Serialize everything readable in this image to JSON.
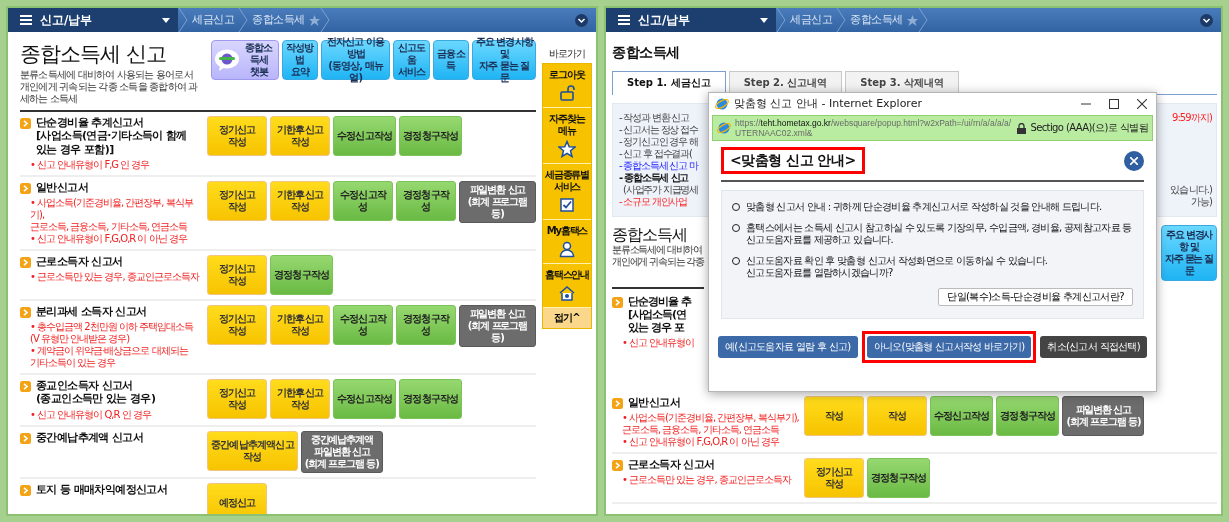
{
  "left_page": {
    "nav": {
      "menu_label": "신고/납부",
      "crumbs": [
        "세금신고",
        "종합소득세"
      ]
    },
    "title": "종합소득세 신고",
    "subtitle": "분류소득세에 대비하여 사용되는 용어로서\n개인에게 귀속되는 각종 소득을 종합하여 과세하는 소득세",
    "top_buttons": [
      {
        "label": "종합소득세\n챗봇",
        "kind": "chatbot"
      },
      {
        "label": "작성방법\n요약",
        "kind": "link"
      },
      {
        "label": "전자신고 이용방법\n(동영상, 매뉴얼)",
        "kind": "link"
      },
      {
        "label": "신고도움\n서비스",
        "kind": "link"
      },
      {
        "label": "금융소득",
        "kind": "link"
      },
      {
        "label": "주요 변경사항 및\n자주 묻는 질문",
        "kind": "link"
      }
    ],
    "sections": [
      {
        "title": "단순경비율 추계신고서\n[사업소득(연금·기타소득이 함께\n있는 경우 포함)]",
        "notes": [
          "• 신고 안내유형이 F,G 인 경우"
        ],
        "buttons": [
          {
            "label": "정기신고\n작성",
            "kind": "filing"
          },
          {
            "label": "기한후신고\n작성",
            "kind": "filing"
          },
          {
            "label": "수정신고작성",
            "kind": "correction"
          },
          {
            "label": "경정청구작성",
            "kind": "correction"
          }
        ]
      },
      {
        "title": "일반신고서",
        "notes": [
          "• 사업소득(기준경비율, 간편장부, 복식부기),\n근로소득, 금융소득, 기타소득, 연금소득",
          "• 신고 안내유형이 F,G,O,R 이 아닌 경우"
        ],
        "buttons": [
          {
            "label": "정기신고\n작성",
            "kind": "filing"
          },
          {
            "label": "기한후신고\n작성",
            "kind": "filing"
          },
          {
            "label": "수정신고작성",
            "kind": "correction"
          },
          {
            "label": "경정청구작성",
            "kind": "correction"
          },
          {
            "label": "파일변환 신고\n(회계 프로그램 등)",
            "kind": "conversion"
          }
        ]
      },
      {
        "title": "근로소득자 신고서",
        "notes": [
          "• 근로소득만 있는 경우, 종교인근로소득자"
        ],
        "buttons": [
          {
            "label": "정기신고\n작성",
            "kind": "filing"
          },
          {
            "label": "경정청구작성",
            "kind": "correction"
          }
        ]
      },
      {
        "title": "분리과세 소득자 신고서",
        "notes": [
          "• 총수입금액 2천만원 이하 주택임대소득\n(V 유형만 안내받은 경우)",
          "• 계약금이 위약금·배상금으로 대체되는\n기타소득이 있는 경우"
        ],
        "buttons": [
          {
            "label": "정기신고\n작성",
            "kind": "filing"
          },
          {
            "label": "기한후신고\n작성",
            "kind": "filing"
          },
          {
            "label": "수정신고작성",
            "kind": "correction"
          },
          {
            "label": "경정청구작성",
            "kind": "correction"
          },
          {
            "label": "파일변환 신고\n(회계 프로그램 등)",
            "kind": "conversion"
          }
        ]
      },
      {
        "title": "종교인소득자 신고서\n(종교인소득만 있는 경우)",
        "notes": [
          "• 신고 안내유형이 Q,R 인 경우"
        ],
        "buttons": [
          {
            "label": "정기신고\n작성",
            "kind": "filing"
          },
          {
            "label": "기한후신고\n작성",
            "kind": "filing"
          },
          {
            "label": "수정신고작성",
            "kind": "correction"
          },
          {
            "label": "경정청구작성",
            "kind": "correction"
          }
        ]
      },
      {
        "title": "중간예납추계액 신고서",
        "buttons": [
          {
            "label": "중간예납추계액신고\n작성",
            "kind": "filing"
          },
          {
            "label": "중간예납추계액\n파일변환 신고\n(회계 프로그램 등)",
            "kind": "conversion"
          }
        ]
      },
      {
        "title": "토지 등 매매차익예정신고서",
        "buttons": [
          {
            "label": "예정신고",
            "kind": "filing"
          }
        ]
      }
    ],
    "quick_menu": {
      "title": "바로가기",
      "items": [
        {
          "label": "로그아웃",
          "kind": "logout"
        },
        {
          "label": "자주찾는\n메뉴",
          "kind": "favorite"
        },
        {
          "label": "세금종류별\n서비스",
          "kind": "service"
        },
        {
          "label": "My홈택스",
          "kind": "account"
        },
        {
          "label": "홈택스안내",
          "kind": "guide"
        }
      ],
      "collapse": "접기^"
    }
  },
  "right_page": {
    "nav": {
      "menu_label": "신고/납부",
      "crumbs": [
        "세금신고",
        "종합소득세"
      ]
    },
    "heading": "종합소득세",
    "tabs": [
      {
        "label": "Step 1. 세금신고",
        "selected": true
      },
      {
        "label": "Step 2. 신고내역",
        "selected": false
      },
      {
        "label": "Step 3. 삭제내역",
        "selected": false
      }
    ],
    "notice_lines": [
      {
        "text": "- 작성과 변환 신고",
        "kind": "plain",
        "tail": {
          "text": "9:59까지)",
          "kind": "red"
        }
      },
      {
        "text": "- 신고서는 정상 접수",
        "kind": "plain"
      },
      {
        "text": "- 정기신고인 경우 해",
        "kind": "plain"
      },
      {
        "text": "- 신고 후 접수결과(",
        "kind": "plain"
      },
      {
        "text": "- 종합소득세 신고 마",
        "kind": "blue"
      },
      {
        "text": "- 종합소득세 신고",
        "kind": "bold"
      },
      {
        "text": "(사업주가 지급명세",
        "kind": "indent",
        "tail": {
          "text": "있습니다.)",
          "kind": "plain"
        }
      },
      {
        "text": "- 소규모 개인사업",
        "kind": "red",
        "tail": {
          "text": "가능)",
          "kind": "plain"
        }
      }
    ],
    "title": "종합소득세",
    "subtitle": "분류소득세에 대비하여\n개인에게 귀속되는 각종",
    "faq_button": "주요 변경사항 및\n자주 묻는 질문",
    "partial_section": {
      "title": "단순경비율 추\n[사업소득(연\n있는 경우 포",
      "notes": [
        "• 신고 안내유형이"
      ]
    },
    "sections": [
      {
        "title": "일반신고서",
        "notes": [
          "• 사업소득(기준경비율, 간편장부, 복식부기),\n근로소득, 금융소득, 기타소득, 연금소득",
          "• 신고 안내유형이 F,G,O,R 이 아닌 경우"
        ],
        "buttons": [
          {
            "label": "작성",
            "kind": "filing"
          },
          {
            "label": "작성",
            "kind": "filing"
          },
          {
            "label": "수정신고작성",
            "kind": "correction"
          },
          {
            "label": "경정청구작성",
            "kind": "correction"
          },
          {
            "label": "파일변환 신고\n(회계 프로그램 등)",
            "kind": "conversion"
          }
        ]
      },
      {
        "title": "근로소득자 신고서",
        "notes": [
          "• 근로소득만 있는 경우, 종교인근로소득자"
        ],
        "buttons": [
          {
            "label": "정기신고\n작성",
            "kind": "filing"
          },
          {
            "label": "경정청구작성",
            "kind": "correction"
          }
        ]
      }
    ],
    "popup": {
      "window_title": "맞춤형 신고 안내 - Internet Explorer",
      "url": {
        "scheme": "https://",
        "host": "teht.hometax.go.kr",
        "path": "/websquare/popup.html?w2xPath=/ui/rn/a/a/a/a/UTERNAAC02.xml&"
      },
      "certificate": "Sectigo (AAA)(으)로 식별됨",
      "heading": "<맞춤형 신고 안내>",
      "heading_highlighted": true,
      "items": [
        "맞춤형 신고서 안내 : 귀하께 단순경비율 추계신고서로 작성하실 것을 안내해 드립니다.",
        "홈택스에서는 소득세 신고시 참고하실 수 있도록 기장의무, 수입금액, 경비율, 공제참고자료 등\n신고도움자료를 제공하고 있습니다.",
        "신고도움자료 확인 후 맞춤형 신고서 작성화면으로 이동하실 수 있습니다.\n신고도움자료를 열람하시겠습니까?"
      ],
      "help_button": "단일(복수)소득-단순경비율 추계신고서란?",
      "buttons": [
        {
          "label": "예(신고도움자료 열람 후 신고)",
          "kind": "primary",
          "highlighted": false
        },
        {
          "label": "아니오(맞춤형 신고서작성 바로가기)",
          "kind": "primary",
          "highlighted": true
        },
        {
          "label": "취소(신고서 직접선택)",
          "kind": "dark",
          "highlighted": false
        }
      ]
    }
  }
}
